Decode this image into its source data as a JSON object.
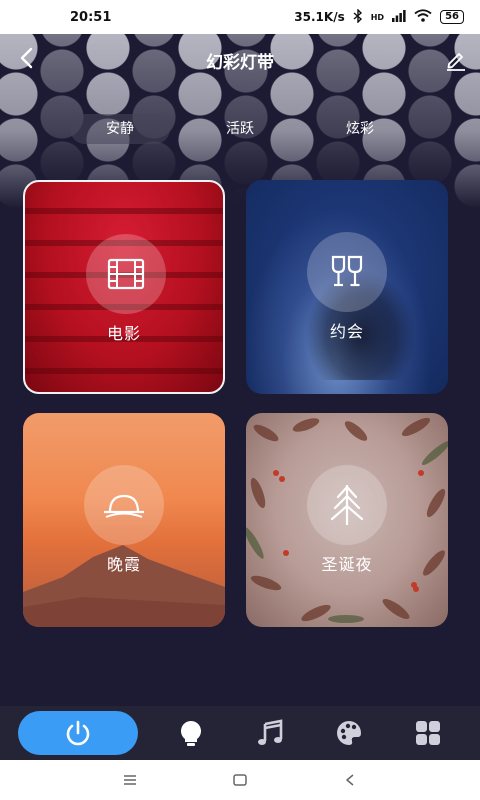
{
  "status_bar": {
    "time": "20:51",
    "network_speed": "35.1K/s",
    "network_type": "HD",
    "battery": "56"
  },
  "header": {
    "title": "幻彩灯带",
    "back_icon": "chevron-left-icon",
    "edit_icon": "pencil-icon"
  },
  "segments": [
    {
      "label": "安静",
      "active": true
    },
    {
      "label": "活跃",
      "active": false
    },
    {
      "label": "炫彩",
      "active": false
    }
  ],
  "scenes": [
    {
      "label": "电影",
      "icon": "film-icon",
      "selected": true
    },
    {
      "label": "约会",
      "icon": "wine-glasses-icon",
      "selected": false
    },
    {
      "label": "晚霞",
      "icon": "sunset-icon",
      "selected": false
    },
    {
      "label": "圣诞夜",
      "icon": "christmas-tree-icon",
      "selected": false
    }
  ],
  "bottom_nav": [
    {
      "icon": "power-icon",
      "active": true
    },
    {
      "icon": "bulb-icon",
      "active": false
    },
    {
      "icon": "music-note-icon",
      "active": false
    },
    {
      "icon": "palette-icon",
      "active": false
    },
    {
      "icon": "grid-icon",
      "active": false
    }
  ],
  "colors": {
    "background": "#1d1b33",
    "accent": "#3a9cf5",
    "nav_background": "#252436"
  }
}
